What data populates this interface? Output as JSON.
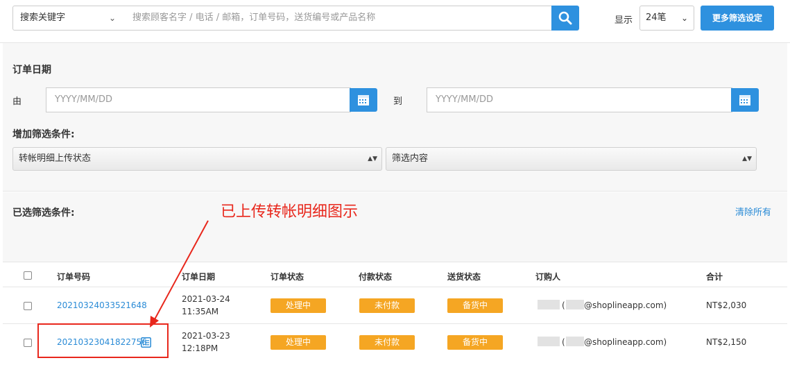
{
  "search": {
    "field_select": "搜索关键字",
    "placeholder": "搜索顾客名字 / 电话 / 邮箱，订单号码，送货编号或产品名称",
    "show_label": "显示",
    "per_page": "24笔",
    "more_filters": "更多筛选设定"
  },
  "filters": {
    "order_date_title": "订单日期",
    "from_label": "由",
    "to_label": "到",
    "date_placeholder_from": "YYYY/MM/DD",
    "date_placeholder_to": "YYYY/MM/DD",
    "add_filter_title": "增加筛选条件:",
    "filter_field": "转帐明细上传状态",
    "filter_value": "筛选内容"
  },
  "selected_filters": {
    "title": "已选筛选条件:",
    "clear_all": "清除所有"
  },
  "annotation": {
    "text": "已上传转帐明细图示",
    "color": "#e8271c"
  },
  "table": {
    "headers": {
      "order_no": "订单号码",
      "order_date": "订单日期",
      "order_status": "订单状态",
      "payment_status": "付款状态",
      "delivery_status": "送货状态",
      "customer": "订购人",
      "total": "合计"
    },
    "rows": [
      {
        "order_no": "20210324033521648",
        "date": "2021-03-24",
        "time": "11:35AM",
        "order_status": "处理中",
        "payment_status": "未付款",
        "delivery_status": "备货中",
        "customer_open": "(",
        "customer_email": "@shoplineapp.com)",
        "total": "NT$2,030"
      },
      {
        "order_no": "20210323041822756",
        "date": "2021-03-23",
        "time": "12:18PM",
        "order_status": "处理中",
        "payment_status": "未付款",
        "delivery_status": "备货中",
        "customer_open": "(",
        "customer_email": "@shoplineapp.com)",
        "total": "NT$2,150"
      }
    ]
  },
  "colors": {
    "accent": "#2e91df",
    "badge": "#f5a623",
    "link": "#2a8bd6"
  }
}
